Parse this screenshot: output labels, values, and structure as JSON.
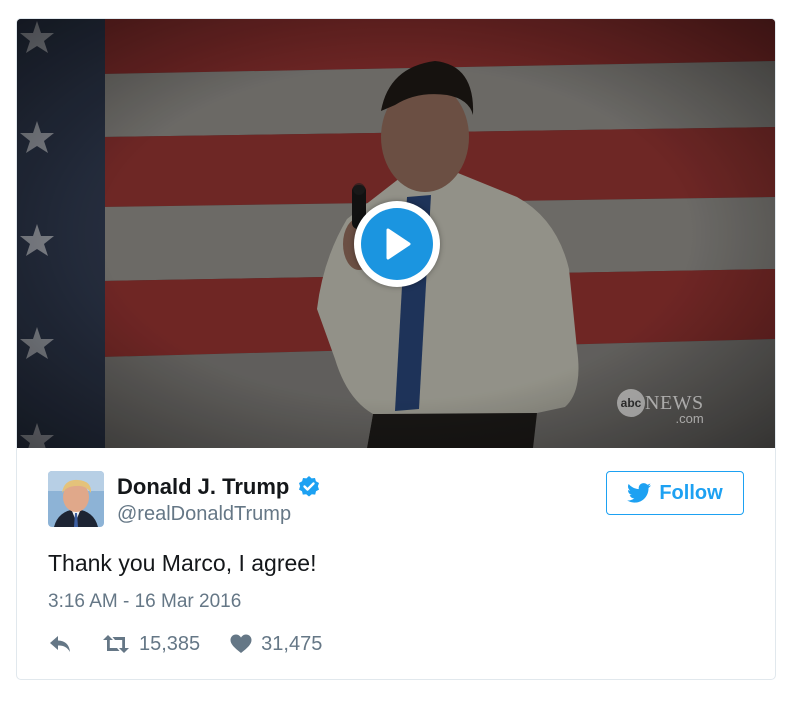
{
  "media": {
    "type": "video",
    "play_icon": "play-icon",
    "watermark": {
      "abc": "abc",
      "news": "NEWS",
      "domain": ".com"
    }
  },
  "author": {
    "display_name": "Donald J. Trump",
    "handle": "@realDonaldTrump",
    "verified": true,
    "verified_icon": "verified-badge-icon"
  },
  "follow_button": {
    "label": "Follow",
    "icon": "twitter-bird-icon"
  },
  "tweet": {
    "text": "Thank you Marco, I agree!",
    "timestamp": "3:16 AM - 16 Mar 2016"
  },
  "actions": {
    "reply_icon": "reply-icon",
    "retweet_count": "15,385",
    "retweet_icon": "retweet-icon",
    "like_count": "31,475",
    "like_icon": "heart-icon"
  },
  "colors": {
    "accent": "#1da1f2",
    "play_button": "#1b95e0",
    "text_primary": "#14171a",
    "text_secondary": "#657786"
  }
}
